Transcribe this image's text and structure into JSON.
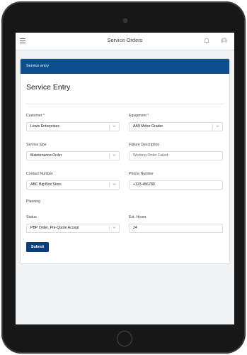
{
  "app": {
    "title": "Service Orders"
  },
  "card": {
    "header": "Service entry",
    "title": "Service Entry"
  },
  "fields": {
    "customer": {
      "label": "Customer",
      "required": "*",
      "value": "Lewis Enterprises"
    },
    "equipment": {
      "label": "Equipment",
      "required": "*",
      "value": "AA9 Motor Grader"
    },
    "service_type": {
      "label": "Service type",
      "value": "Maintenance Order"
    },
    "failure_description": {
      "label": "Failure Description",
      "placeholder": "Working Order Failed"
    },
    "contact_number": {
      "label": "Contact Number",
      "value": "ABC Big Box Store"
    },
    "phone_number": {
      "label": "Phone Number",
      "value": "+123-456789"
    },
    "planning": {
      "label": "Planning"
    },
    "status": {
      "label": "Status",
      "value": "PBP Order, Pre-Quote Accept"
    },
    "est_hours": {
      "label": "Est. Hours",
      "value": "24"
    }
  },
  "actions": {
    "submit": "Submit"
  },
  "icons": {
    "menu": "hamburger-icon",
    "notifications": "bell-icon",
    "user": "avatar-icon",
    "dropdown": "chevron-down-icon"
  },
  "colors": {
    "brand": "#0b4f8f",
    "button": "#0b3d7a",
    "required": "#c23934"
  }
}
